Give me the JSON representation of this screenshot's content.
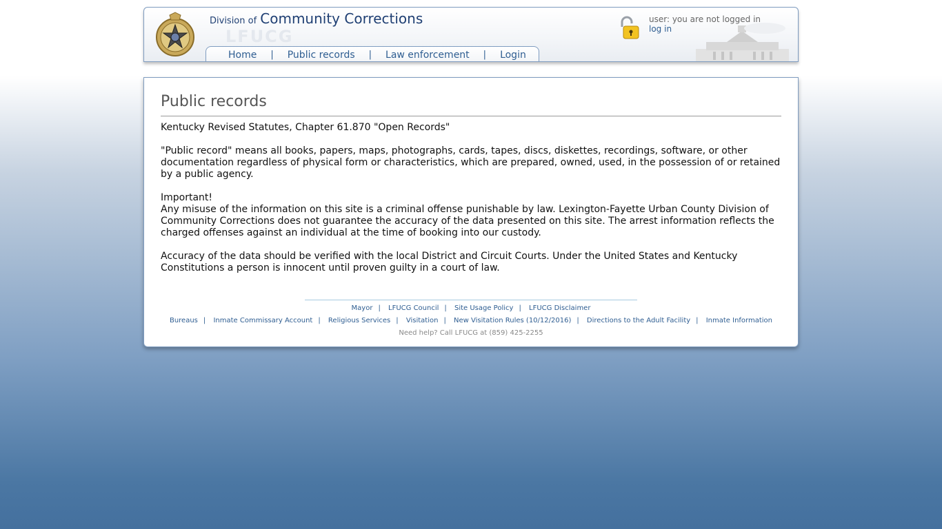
{
  "header": {
    "title_prefix": "Division of",
    "title_main": "Community Corrections",
    "watermark": "LFUCG",
    "user_status": "user: you are not logged in",
    "login_link": "log in"
  },
  "nav": {
    "items": [
      {
        "label": "Home"
      },
      {
        "label": "Public records"
      },
      {
        "label": "Law enforcement"
      },
      {
        "label": "Login"
      }
    ]
  },
  "main": {
    "title": "Public records",
    "paragraphs": [
      "Kentucky Revised Statutes, Chapter 61.870 \"Open Records\"",
      "\"Public record\" means all books, papers, maps, photographs, cards, tapes, discs, diskettes, recordings, software, or other documentation regardless of physical form or characteristics, which are prepared, owned, used, in the possession of or retained by a public agency.",
      "Important!",
      "Any misuse of the information on this site is a criminal offense punishable by law. Lexington-Fayette Urban County Division of Community Corrections does not guarantee the accuracy of the data presented on this site. The arrest information reflects the charged offenses against an individual at the time of booking into our custody.",
      "Accuracy of the data should be verified with the local District and Circuit Courts. Under the United States and Kentucky Constitutions a person is innocent until proven guilty in a court of law."
    ]
  },
  "footer": {
    "row1": [
      "Mayor",
      "LFUCG Council",
      "Site Usage Policy",
      "LFUCG Disclaimer"
    ],
    "row2": [
      "Bureaus",
      "Inmate Commissary Account",
      "Religious Services",
      "Visitation",
      "New Visitation Rules (10/12/2016)",
      "Directions to the Adult Facility",
      "Inmate Information"
    ],
    "help": "Need help? Call LFUCG at (859) 425-2255"
  },
  "icons": {
    "badge": "police-badge-icon",
    "lock": "padlock-open-icon",
    "building": "building-sketch-icon"
  },
  "colors": {
    "link": "#2e5d91",
    "title": "#1f3f73",
    "border": "#7f9cc0"
  }
}
